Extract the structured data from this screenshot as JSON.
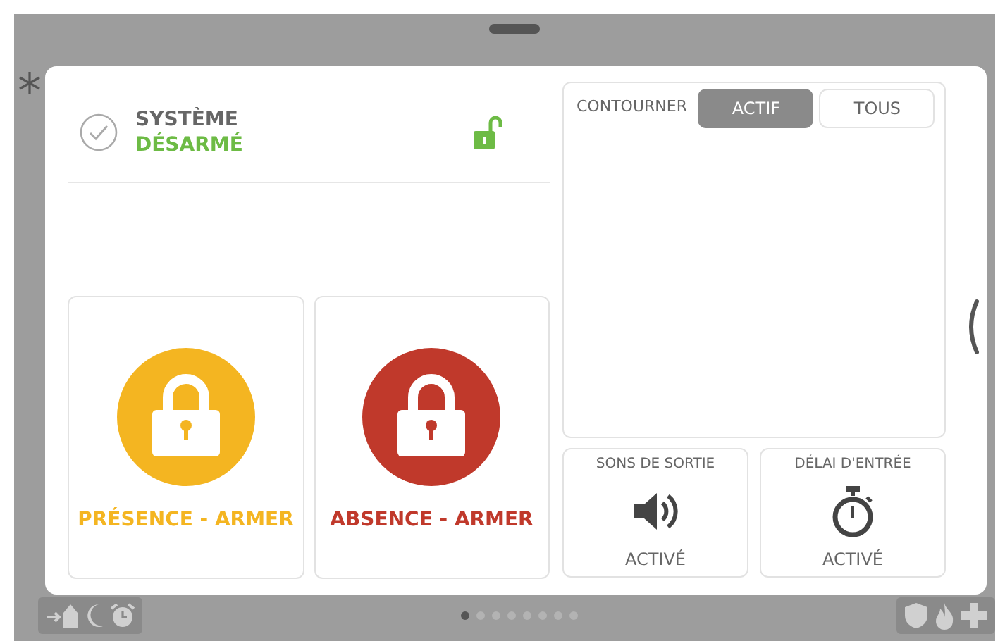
{
  "header": {
    "title": "SYSTÈME",
    "status": "DÉSARMÉ"
  },
  "arm_buttons": [
    {
      "label": "PRÉSENCE - ARMER",
      "color": "#f4b521"
    },
    {
      "label": "ABSENCE - ARMER",
      "color": "#c0392b"
    }
  ],
  "bypass": {
    "label": "CONTOURNER",
    "tabs": [
      {
        "label": "ACTIF",
        "selected": true
      },
      {
        "label": "TOUS",
        "selected": false
      }
    ]
  },
  "settings": [
    {
      "kind": "sound",
      "title": "SONS DE SORTIE",
      "value": "ACTIVÉ"
    },
    {
      "kind": "timer",
      "title": "DÉLAI D'ENTRÉE",
      "value": "ACTIVÉ"
    }
  ],
  "pager": [
    {
      "selected": true
    },
    {
      "selected": false
    },
    {
      "selected": false
    },
    {
      "selected": false
    },
    {
      "selected": false
    },
    {
      "selected": false
    },
    {
      "selected": false
    },
    {
      "selected": false
    }
  ]
}
